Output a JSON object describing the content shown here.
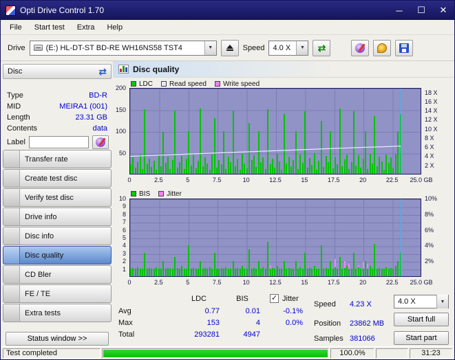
{
  "window": {
    "title": "Opti Drive Control 1.70"
  },
  "menu": {
    "items": [
      "File",
      "Start test",
      "Extra",
      "Help"
    ]
  },
  "toolbar": {
    "drive_label": "Drive",
    "drive_value": "(E:)  HL-DT-ST BD-RE  WH16NS58 TST4",
    "speed_label": "Speed",
    "speed_value": "4.0 X"
  },
  "sidebar": {
    "header": "Disc",
    "info": [
      {
        "label": "Type",
        "value": "BD-R"
      },
      {
        "label": "MID",
        "value": "MEIRA1 (001)"
      },
      {
        "label": "Length",
        "value": "23.31 GB"
      },
      {
        "label": "Contents",
        "value": "data"
      }
    ],
    "label_field": {
      "label": "Label",
      "value": ""
    },
    "buttons": [
      "Transfer rate",
      "Create test disc",
      "Verify test disc",
      "Drive info",
      "Disc info",
      "Disc quality",
      "CD Bler",
      "FE / TE",
      "Extra tests"
    ],
    "active_button": "Disc quality",
    "status_window": "Status window >>"
  },
  "main": {
    "title": "Disc quality"
  },
  "stats": {
    "headers": {
      "ldc": "LDC",
      "bis": "BIS"
    },
    "jitter": {
      "label": "Jitter",
      "checked": true
    },
    "rows": [
      {
        "label": "Avg",
        "ldc": "0.77",
        "bis": "0.01",
        "jitter": "-0.1%"
      },
      {
        "label": "Max",
        "ldc": "153",
        "bis": "4",
        "jitter": "0.0%"
      },
      {
        "label": "Total",
        "ldc": "293281",
        "bis": "4947",
        "jitter": ""
      }
    ],
    "info": [
      {
        "label": "Speed",
        "value": "4.23 X"
      },
      {
        "label": "Position",
        "value": "23862 MB"
      },
      {
        "label": "Samples",
        "value": "381066"
      }
    ],
    "speed_select": "4.0 X",
    "start_full": "Start full",
    "start_part": "Start part"
  },
  "statusbar": {
    "text": "Test completed",
    "percent": "100.0%",
    "time": "31:23",
    "progress": 100
  },
  "colors": {
    "titlebar": "#1c1c6e",
    "plot_bg": "#9192c6",
    "grid": "#7b7cb4",
    "bar_green": "#00c400",
    "read_line": "#e9e9ff",
    "pink": "#ff7dff",
    "pos_line": "#35b9f0",
    "value_blue": "#0000cd",
    "active_btn_top": "#a9c6ee",
    "active_btn_bottom": "#5b88cc",
    "progress_green": "#00c400"
  },
  "chart_data": [
    {
      "type": "bar",
      "title": "Disc quality - LDC",
      "xlabel": "GB",
      "x_range": [
        0,
        25
      ],
      "y_left_range": [
        0,
        200
      ],
      "legend": [
        {
          "label": "LDC",
          "color": "#00c800"
        },
        {
          "label": "Read speed",
          "color": "#e9e9ff"
        },
        {
          "label": "Write speed",
          "color": "#ff7dff"
        }
      ],
      "y_left_ticks": [
        {
          "t": "200",
          "f": 0.0
        },
        {
          "t": "150",
          "f": 0.25
        },
        {
          "t": "100",
          "f": 0.5
        },
        {
          "t": "50",
          "f": 0.75
        }
      ],
      "y_right_ticks": [
        {
          "t": "18 X",
          "f": 0.053
        },
        {
          "t": "16 X",
          "f": 0.158
        },
        {
          "t": "14 X",
          "f": 0.263
        },
        {
          "t": "12 X",
          "f": 0.368
        },
        {
          "t": "10 X",
          "f": 0.474
        },
        {
          "t": "8 X",
          "f": 0.579
        },
        {
          "t": "6 X",
          "f": 0.684
        },
        {
          "t": "4 X",
          "f": 0.789
        },
        {
          "t": "2 X",
          "f": 0.895
        }
      ],
      "x_ticks": [
        {
          "t": "0",
          "f": 0.0
        },
        {
          "t": "2.5",
          "f": 0.1
        },
        {
          "t": "5",
          "f": 0.2
        },
        {
          "t": "7.5",
          "f": 0.3
        },
        {
          "t": "10",
          "f": 0.4
        },
        {
          "t": "12.5",
          "f": 0.5
        },
        {
          "t": "15",
          "f": 0.6
        },
        {
          "t": "17.5",
          "f": 0.7
        },
        {
          "t": "20",
          "f": 0.8
        },
        {
          "t": "22.5",
          "f": 0.9
        },
        {
          "t": "25.0 GB",
          "f": 1.0
        }
      ],
      "bars_max": 200,
      "bars": [
        22,
        38,
        14,
        27,
        45,
        12,
        152,
        24,
        36,
        16,
        30,
        10,
        44,
        18,
        98,
        26,
        40,
        12,
        33,
        149,
        15,
        28,
        42,
        11,
        36,
        100,
        20,
        47,
        13,
        30,
        153,
        18,
        38,
        24,
        10,
        45,
        130,
        15,
        33,
        22,
        100,
        12,
        40,
        28,
        148,
        17,
        35,
        10,
        46,
        25,
        13,
        120,
        32,
        44,
        16,
        100,
        27,
        38,
        11,
        151,
        22,
        35,
        14,
        47,
        29,
        10,
        140,
        24,
        41,
        18,
        33,
        100,
        12,
        45,
        26,
        147,
        15,
        37,
        21,
        48,
        10,
        30,
        125,
        16,
        42,
        27,
        100,
        13,
        39,
        23,
        153,
        18,
        34,
        45,
        11,
        28,
        146,
        20,
        43,
        15,
        36,
        100,
        12,
        47,
        24,
        135,
        17,
        40,
        29,
        10,
        45,
        26,
        38,
        14,
        46,
        100,
        140,
        0,
        0,
        0,
        0,
        0,
        0,
        0,
        0
      ],
      "line": {
        "name": "Read speed",
        "color": "#e9e9ff",
        "ymax": 19,
        "points": [
          [
            0,
            3.9
          ],
          [
            2.5,
            4.15
          ],
          [
            5,
            4.4
          ],
          [
            7.5,
            4.65
          ],
          [
            10,
            4.9
          ],
          [
            12.5,
            5.15
          ],
          [
            15,
            5.4
          ],
          [
            17.5,
            5.65
          ],
          [
            20,
            5.9
          ],
          [
            22,
            6.05
          ],
          [
            23.3,
            6.2
          ],
          [
            23.35,
            0.5
          ]
        ]
      },
      "position_marker_x": 23.3
    },
    {
      "type": "bar",
      "title": "Disc quality - BIS / Jitter",
      "xlabel": "GB",
      "x_range": [
        0,
        25
      ],
      "y_left_range": [
        0,
        10
      ],
      "legend": [
        {
          "label": "BIS",
          "color": "#00c800"
        },
        {
          "label": "Jitter",
          "color": "#ff7dff"
        }
      ],
      "y_left_ticks": [
        {
          "t": "10",
          "f": 0.0
        },
        {
          "t": "9",
          "f": 0.1
        },
        {
          "t": "8",
          "f": 0.2
        },
        {
          "t": "7",
          "f": 0.3
        },
        {
          "t": "6",
          "f": 0.4
        },
        {
          "t": "5",
          "f": 0.5
        },
        {
          "t": "4",
          "f": 0.6
        },
        {
          "t": "3",
          "f": 0.7
        },
        {
          "t": "2",
          "f": 0.8
        },
        {
          "t": "1",
          "f": 0.9
        }
      ],
      "y_right_ticks": [
        {
          "t": "10%",
          "f": 0.0
        },
        {
          "t": "8%",
          "f": 0.2
        },
        {
          "t": "6%",
          "f": 0.4
        },
        {
          "t": "4%",
          "f": 0.6
        },
        {
          "t": "2%",
          "f": 0.8
        }
      ],
      "x_ticks": [
        {
          "t": "0",
          "f": 0.0
        },
        {
          "t": "2.5",
          "f": 0.1
        },
        {
          "t": "5",
          "f": 0.2
        },
        {
          "t": "7.5",
          "f": 0.3
        },
        {
          "t": "10",
          "f": 0.4
        },
        {
          "t": "12.5",
          "f": 0.5
        },
        {
          "t": "15",
          "f": 0.6
        },
        {
          "t": "17.5",
          "f": 0.7
        },
        {
          "t": "20",
          "f": 0.8
        },
        {
          "t": "22.5",
          "f": 0.9
        },
        {
          "t": "25.0 GB",
          "f": 1.0
        }
      ],
      "bars_max": 10,
      "bars": [
        1,
        1.1,
        1,
        1.2,
        1,
        1,
        3,
        1,
        1.1,
        1,
        1,
        1.2,
        1,
        1,
        2,
        1,
        1.1,
        1,
        1,
        2.5,
        1.1,
        1,
        1.3,
        1,
        1,
        4,
        1,
        1.1,
        1,
        1,
        2,
        1,
        1.1,
        1,
        1.2,
        1,
        3,
        1,
        1,
        1.1,
        1,
        1.2,
        1,
        1,
        2,
        1,
        1.1,
        1,
        1.3,
        1,
        1,
        3.5,
        1,
        1.1,
        1,
        2,
        1,
        1.2,
        1,
        4.5,
        1,
        1.1,
        1,
        1.3,
        1,
        1,
        2,
        1,
        1.1,
        1,
        1,
        2,
        1,
        1.2,
        1,
        3,
        1,
        1.1,
        1,
        1.3,
        1,
        1,
        4,
        1,
        1.1,
        1,
        2,
        1,
        1.2,
        1,
        2.5,
        1,
        1.1,
        1.3,
        1,
        1,
        3,
        1,
        1.2,
        1,
        1,
        2,
        1,
        1.3,
        1,
        4.2,
        1,
        1.1,
        1,
        1,
        1.2,
        1,
        1.1,
        1,
        1.3,
        2,
        3,
        0,
        0,
        0,
        0,
        0,
        0,
        0,
        0
      ],
      "jitter_bars": [
        [
          30,
          1.2
        ],
        [
          60,
          1.4
        ],
        [
          86,
          1.8
        ],
        [
          88,
          2.2
        ],
        [
          90,
          1.5
        ],
        [
          92,
          2.0
        ],
        [
          94,
          1.6
        ],
        [
          96,
          2.3
        ],
        [
          98,
          1.4
        ],
        [
          100,
          1.9
        ],
        [
          102,
          1.6
        ]
      ],
      "position_marker_x": 23.3
    }
  ]
}
